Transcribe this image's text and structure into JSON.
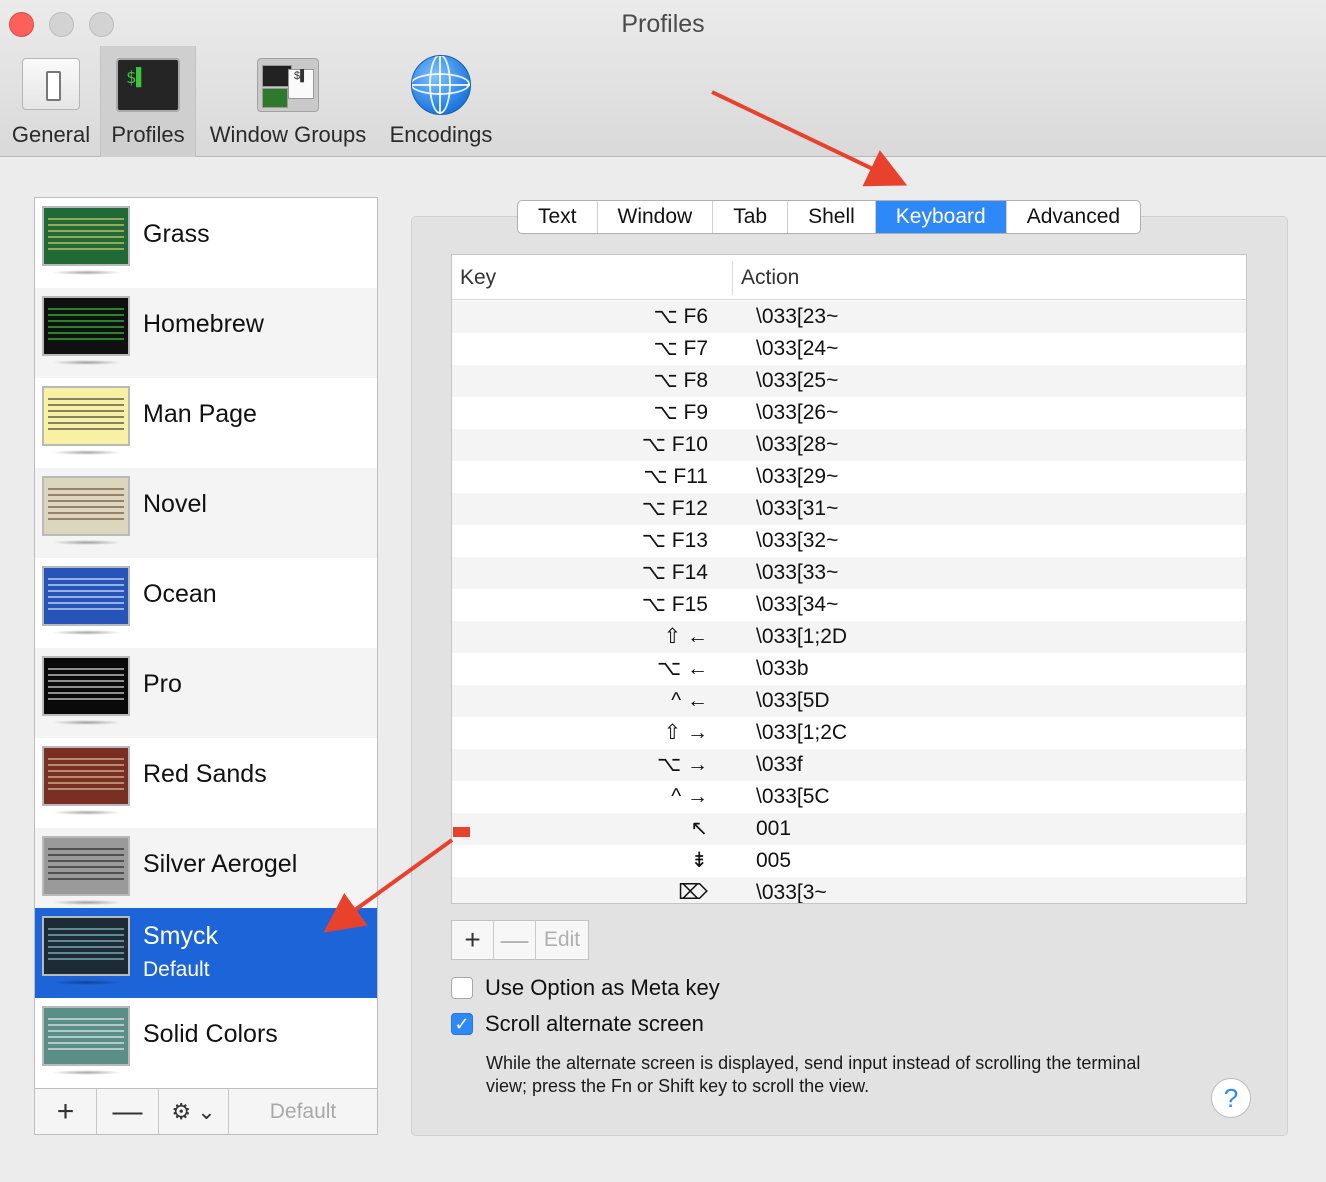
{
  "window": {
    "title": "Profiles"
  },
  "toolbar": {
    "items": [
      {
        "label": "General"
      },
      {
        "label": "Profiles"
      },
      {
        "label": "Window Groups"
      },
      {
        "label": "Encodings"
      }
    ],
    "selected": "Profiles"
  },
  "profiles": {
    "items": [
      {
        "name": "Grass",
        "thumb_bg": "#1f6a36",
        "thumb_fg": "#e9d26a"
      },
      {
        "name": "Homebrew",
        "thumb_bg": "#101010",
        "thumb_fg": "#39d43a"
      },
      {
        "name": "Man Page",
        "thumb_bg": "#f8f1a4",
        "thumb_fg": "#3a3a3a"
      },
      {
        "name": "Novel",
        "thumb_bg": "#ddd6bf",
        "thumb_fg": "#6b4a35"
      },
      {
        "name": "Ocean",
        "thumb_bg": "#2654b8",
        "thumb_fg": "#e4edf9"
      },
      {
        "name": "Pro",
        "thumb_bg": "#0a0a0a",
        "thumb_fg": "#e8e8e8"
      },
      {
        "name": "Red Sands",
        "thumb_bg": "#7a2f24",
        "thumb_fg": "#e0c9a0"
      },
      {
        "name": "Silver Aerogel",
        "thumb_bg": "#9a9a9a",
        "thumb_fg": "#222222"
      },
      {
        "name": "Smyck",
        "thumb_bg": "#1d2b34",
        "thumb_fg": "#8fc9d8",
        "subtitle": "Default",
        "selected": true
      },
      {
        "name": "Solid Colors",
        "thumb_bg": "#5a8f85",
        "thumb_fg": "#f2f2f2"
      }
    ],
    "bottom_bar": {
      "add": "+",
      "remove": "—",
      "gear": "⚙ ⌄",
      "default": "Default"
    }
  },
  "tabs": {
    "items": [
      "Text",
      "Window",
      "Tab",
      "Shell",
      "Keyboard",
      "Advanced"
    ],
    "active": "Keyboard"
  },
  "keyboard_table": {
    "headers": {
      "key": "Key",
      "action": "Action"
    },
    "rows": [
      {
        "key": "⌥ F6",
        "action": "\\033[23~"
      },
      {
        "key": "⌥ F7",
        "action": "\\033[24~"
      },
      {
        "key": "⌥ F8",
        "action": "\\033[25~"
      },
      {
        "key": "⌥ F9",
        "action": "\\033[26~"
      },
      {
        "key": "⌥ F10",
        "action": "\\033[28~"
      },
      {
        "key": "⌥ F11",
        "action": "\\033[29~"
      },
      {
        "key": "⌥ F12",
        "action": "\\033[31~"
      },
      {
        "key": "⌥ F13",
        "action": "\\033[32~"
      },
      {
        "key": "⌥ F14",
        "action": "\\033[33~"
      },
      {
        "key": "⌥ F15",
        "action": "\\033[34~"
      },
      {
        "key": "⇧ ←",
        "action": "\\033[1;2D"
      },
      {
        "key": "⌥ ←",
        "action": "\\033b"
      },
      {
        "key": "^ ←",
        "action": "\\033[5D"
      },
      {
        "key": "⇧ →",
        "action": "\\033[1;2C"
      },
      {
        "key": "⌥ →",
        "action": "\\033f"
      },
      {
        "key": "^ →",
        "action": "\\033[5C"
      },
      {
        "key": "↖",
        "action": "001"
      },
      {
        "key": "⇟",
        "action": "005"
      },
      {
        "key": "⌦",
        "action": "\\033[3~"
      }
    ],
    "buttons": {
      "add": "+",
      "remove": "—",
      "edit": "Edit"
    }
  },
  "options": {
    "use_option_as_meta": {
      "label": "Use Option as Meta key",
      "checked": false
    },
    "scroll_alternate_screen": {
      "label": "Scroll alternate screen",
      "checked": true
    },
    "description": "While the alternate screen is displayed, send input instead of scrolling the terminal view; press the Fn or Shift key to scroll the view."
  },
  "help": "?",
  "colors": {
    "accent": "#2f88f8",
    "selection": "#1d64d8",
    "annotation_arrow": "#e8412c"
  }
}
